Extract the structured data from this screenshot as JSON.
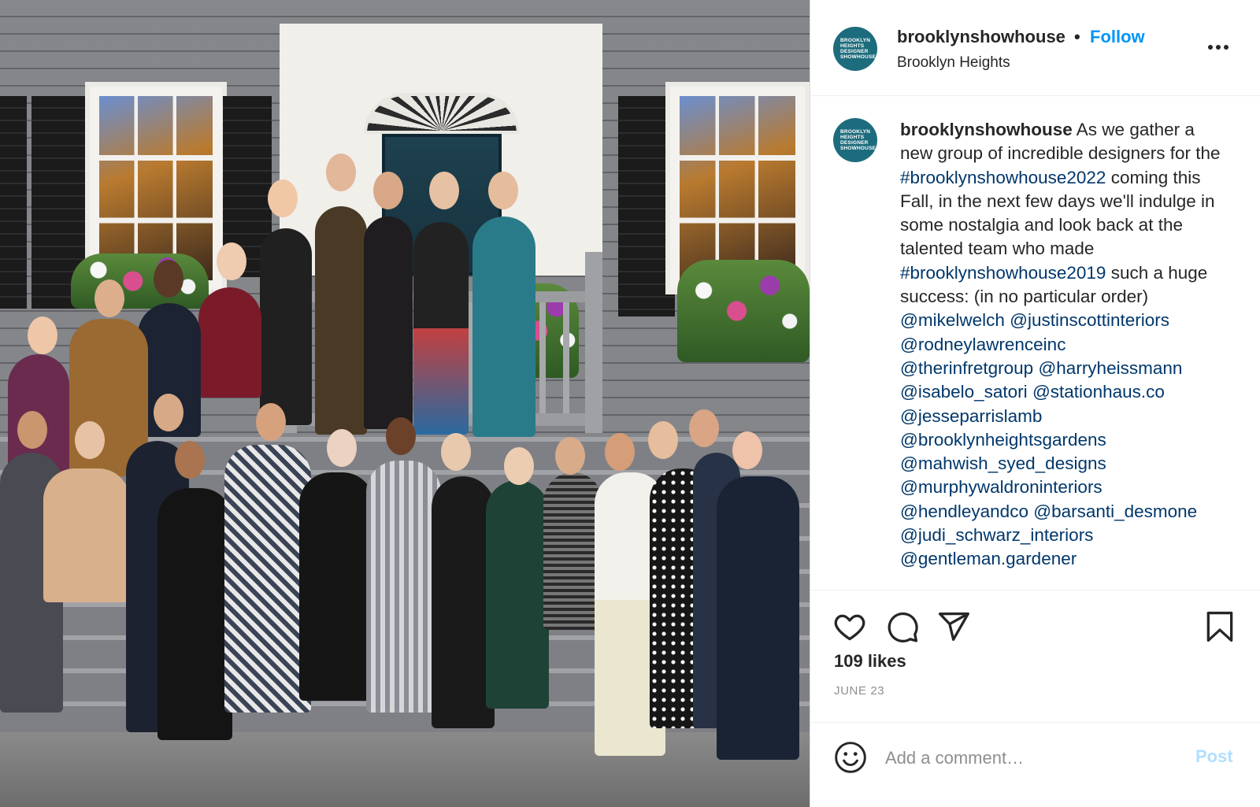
{
  "post": {
    "username": "brooklynshowhouse",
    "separator": "•",
    "follow_label": "Follow",
    "location": "Brooklyn Heights",
    "more_icon": "more-horizontal-icon",
    "avatar_text": [
      "BROOKLYN",
      "HEIGHTS",
      "DESIGNER",
      "SHOWHOUSE"
    ],
    "avatar_color": "#1d6c7d"
  },
  "caption": {
    "username": "brooklynshowhouse",
    "text_1": " As we gather a new group of incredible designers for the ",
    "hashtag_1": "#brooklynshowhouse2022",
    "text_2": " coming this Fall, in the next few days we'll indulge in some nostalgia and look back at the talented team who made ",
    "hashtag_2": "#brooklynshowhouse2019",
    "text_3": " such a huge success: (in no particular order)",
    "mentions": [
      "@mikelwelch",
      "@justinscottinteriors",
      "@rodneylawrenceinc",
      "@therinfretgroup",
      "@harryheissmann",
      "@isabelo_satori",
      "@stationhaus.co",
      "@jesseparrislamb",
      "@brooklynheightsgardens",
      "@mahwish_syed_designs",
      "@murphywaldroninteriors",
      "@hendleyandco",
      "@barsanti_desmone",
      "@judi_schwarz_interiors",
      "@gentleman.gardener"
    ],
    "link_color": "#00376b"
  },
  "actions": {
    "like_icon": "heart-icon",
    "comment_icon": "comment-icon",
    "share_icon": "share-icon",
    "save_icon": "bookmark-icon"
  },
  "likes": "109 likes",
  "date": "JUNE 23",
  "comment": {
    "placeholder": "Add a comment…",
    "post_label": "Post",
    "emoji_icon": "emoji-icon"
  },
  "colors": {
    "accent": "#0095f6",
    "post_disabled": "#b2dffc",
    "secondary_text": "#8e8e8e"
  }
}
